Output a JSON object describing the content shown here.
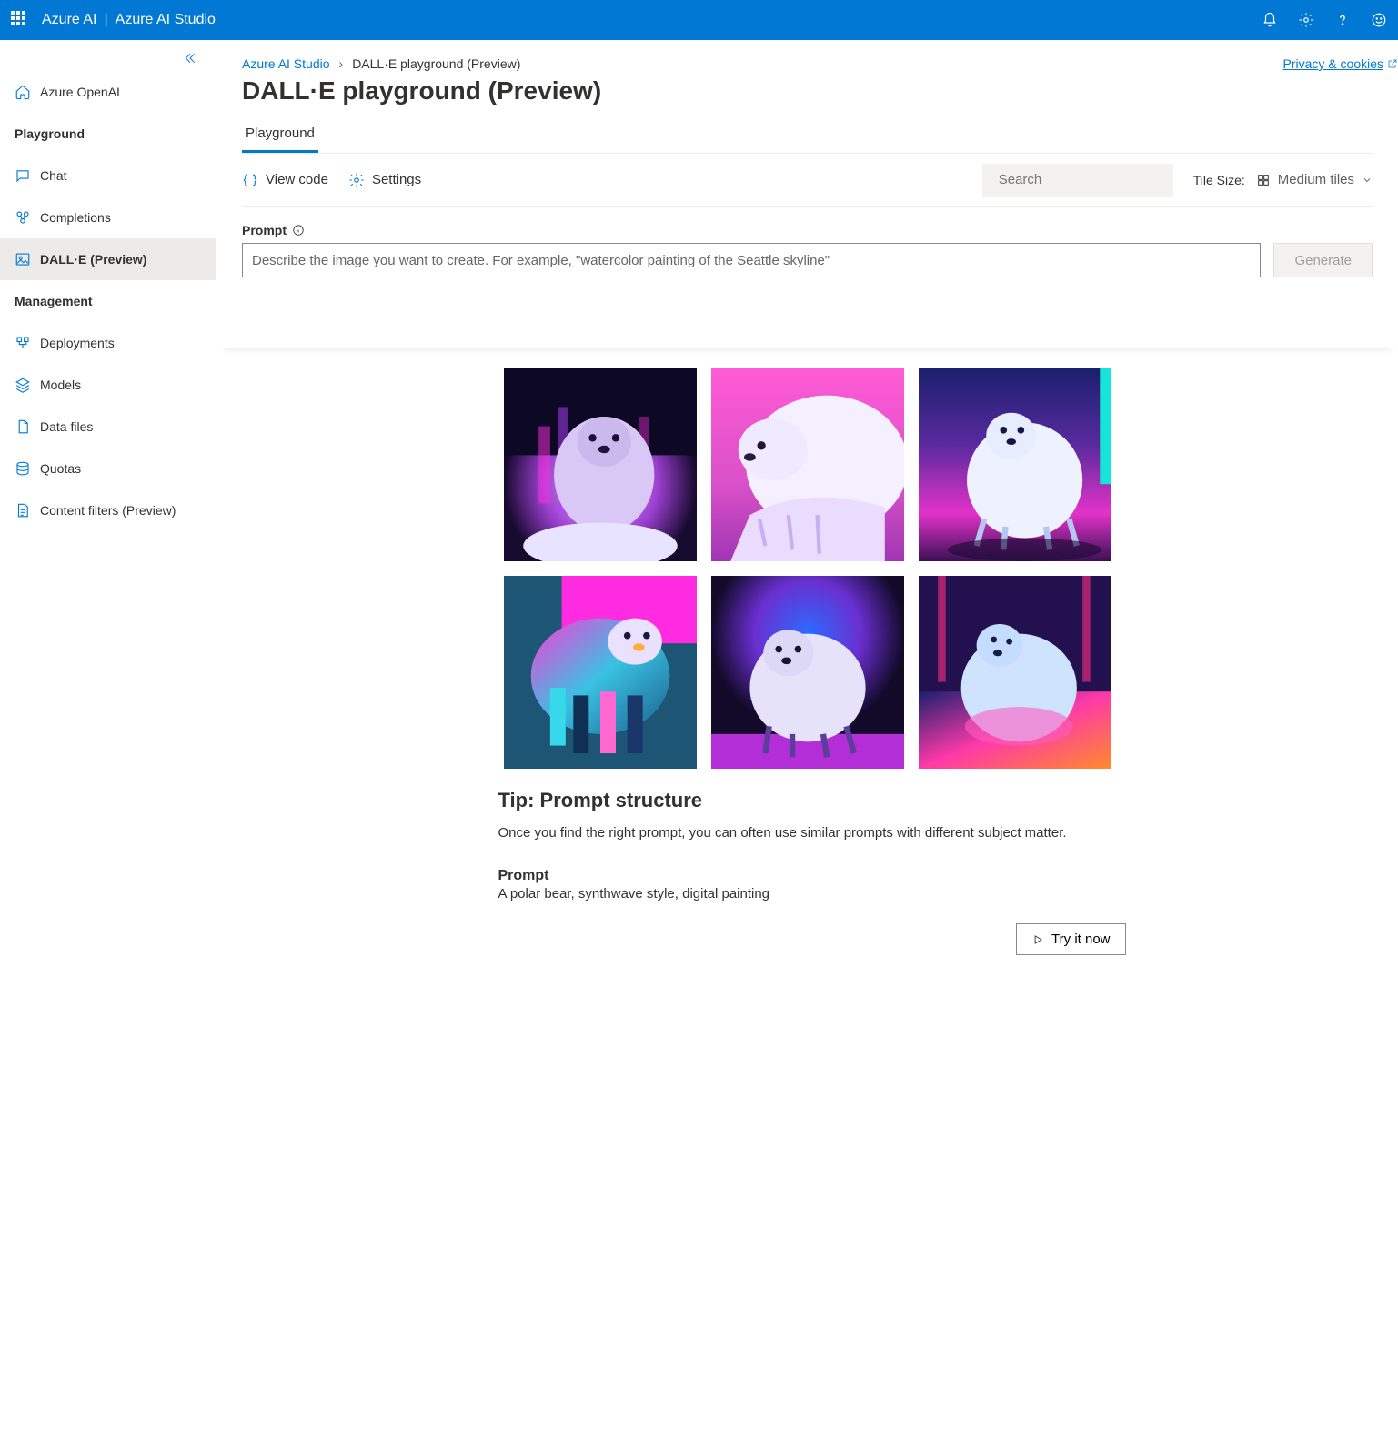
{
  "header": {
    "brand1": "Azure AI",
    "brand2": "Azure AI Studio"
  },
  "sidebar": {
    "link_openai": "Azure OpenAI",
    "section_playground": "Playground",
    "items_playground": [
      {
        "label": "Chat"
      },
      {
        "label": "Completions"
      },
      {
        "label": "DALL·E (Preview)"
      }
    ],
    "section_management": "Management",
    "items_management": [
      {
        "label": "Deployments"
      },
      {
        "label": "Models"
      },
      {
        "label": "Data files"
      },
      {
        "label": "Quotas"
      },
      {
        "label": "Content filters (Preview)"
      }
    ]
  },
  "breadcrumb": {
    "root": "Azure AI Studio",
    "current": "DALL·E playground (Preview)",
    "privacy": "Privacy & cookies"
  },
  "page_title": "DALL·E playground (Preview)",
  "tabs": {
    "playground": "Playground"
  },
  "toolbar": {
    "view_code": "View code",
    "settings": "Settings",
    "search_placeholder": "Search",
    "tile_label": "Tile Size:",
    "tile_value": "Medium tiles"
  },
  "prompt": {
    "label": "Prompt",
    "placeholder": "Describe the image you want to create. For example, \"watercolor painting of the Seattle skyline\"",
    "generate": "Generate"
  },
  "tip": {
    "title": "Tip: Prompt structure",
    "body": "Once you find the right prompt, you can often use similar prompts with different subject matter.",
    "ex_label": "Prompt",
    "ex_text": "A polar bear, synthwave style, digital painting",
    "try": "Try it now"
  }
}
